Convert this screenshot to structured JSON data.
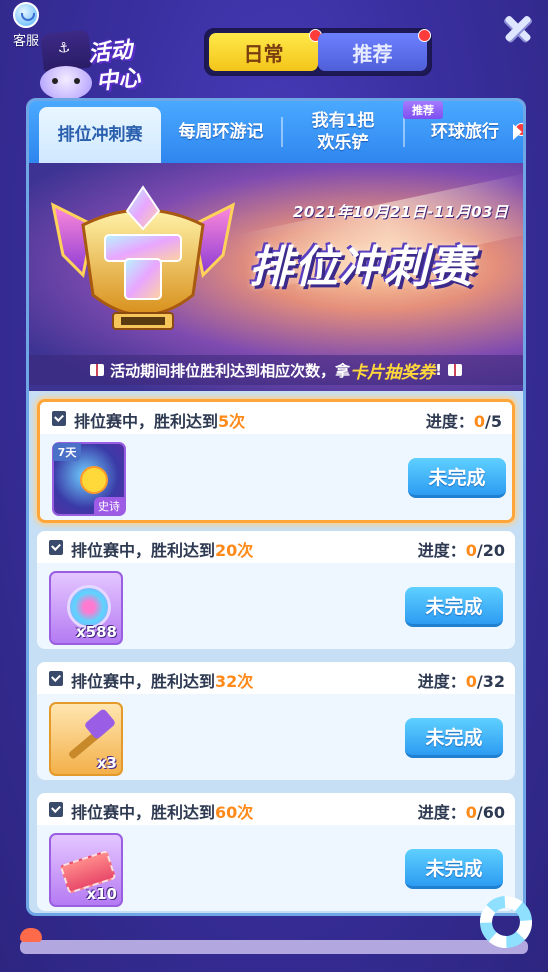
{
  "service": {
    "label": "客服"
  },
  "logo": {
    "line1": "活动",
    "line2": "中心"
  },
  "toggle": {
    "daily": "日常",
    "recommend": "推荐"
  },
  "tabs": [
    {
      "label": "排位冲刺赛"
    },
    {
      "label": "每周环游记"
    },
    {
      "label": "我有1把欢乐铲",
      "line1": "我有1把",
      "line2": "欢乐铲"
    },
    {
      "label": "环球旅行"
    }
  ],
  "tab_badge": "推荐",
  "banner": {
    "date": "2021年10月21日-11月03日",
    "title": "排位冲刺赛",
    "notice_prefix": "活动期间排位胜利达到相应次数，拿",
    "notice_highlight": "卡片抽奖券",
    "notice_suffix": "!"
  },
  "tasks": [
    {
      "prefix": "排位赛中，胜利达到",
      "count": "5次",
      "progress_label": "进度：",
      "current": "0",
      "total": "/5",
      "button": "未完成",
      "duration": "7天",
      "rarity": "史诗",
      "qty": "",
      "highlighted": true,
      "icon": "emoji-avatar-frame-icon"
    },
    {
      "prefix": "排位赛中，胜利达到",
      "count": "20次",
      "progress_label": "进度：",
      "current": "0",
      "total": "/20",
      "button": "未完成",
      "qty": "x588",
      "icon": "fire-coin-icon"
    },
    {
      "prefix": "排位赛中，胜利达到",
      "count": "32次",
      "progress_label": "进度：",
      "current": "0",
      "total": "/32",
      "button": "未完成",
      "qty": "x3",
      "icon": "key-icon"
    },
    {
      "prefix": "排位赛中，胜利达到",
      "count": "60次",
      "progress_label": "进度：",
      "current": "0",
      "total": "/60",
      "button": "未完成",
      "qty": "x10",
      "icon": "camera-ticket-icon"
    }
  ],
  "colors": {
    "accent_orange": "#ff8a1a",
    "button_blue": "#2d9cf2",
    "toggle_active": "#f3c51a"
  }
}
